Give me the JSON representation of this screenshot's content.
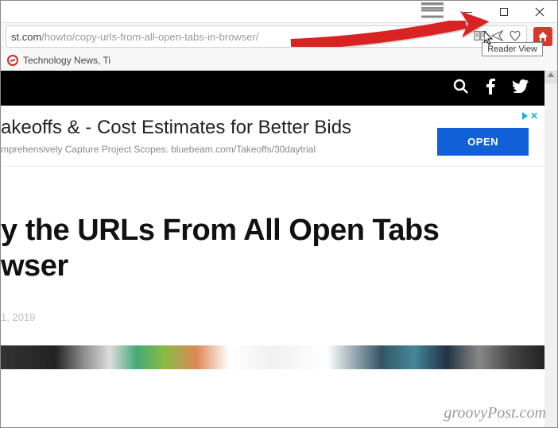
{
  "window": {
    "url_domain": "st.com",
    "url_path": "/howto/copy-urls-from-all-open-tabs-in-browser/",
    "tooltip": "Reader View"
  },
  "bookmarks": {
    "item1": "Technology News, Ti"
  },
  "ad": {
    "headline": "akeoffs & - Cost Estimates for Better Bids",
    "subtext": "mprehensively Capture Project Scopes. bluebeam.com/Takeoffs/30daytrial",
    "cta": "OPEN"
  },
  "article": {
    "title_line1": "y the URLs From All Open Tabs",
    "title_line2": "wser",
    "date": "1, 2019"
  },
  "watermark": "groovyPost.com"
}
